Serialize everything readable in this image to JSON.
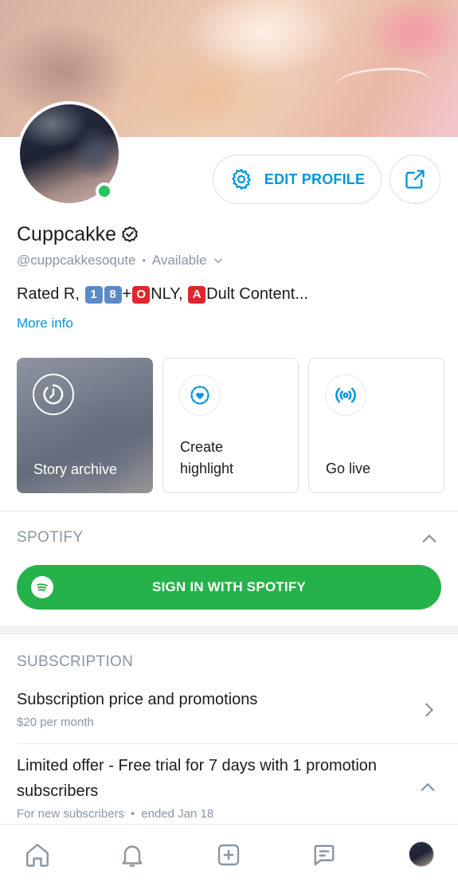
{
  "profile": {
    "name": "Cuppcakke",
    "handle": "@cuppcakkesoqute",
    "separator": "•",
    "status": "Available",
    "bio_prefix": "Rated R,",
    "bio_d1": "1",
    "bio_d2": "8",
    "bio_plus": "+",
    "bio_o": "O",
    "bio_nly": "NLY,",
    "bio_a": "A",
    "bio_dult": "Dult Content...",
    "more_info": "More info",
    "online": true
  },
  "actions": {
    "edit_profile": "EDIT PROFILE"
  },
  "cards": {
    "archive": "Story archive",
    "highlight_l1": "Create",
    "highlight_l2": "highlight",
    "live": "Go live"
  },
  "spotify": {
    "title": "SPOTIFY",
    "sign_in": "SIGN IN WITH SPOTIFY"
  },
  "subscription": {
    "title": "SUBSCRIPTION",
    "price_title": "Subscription price and promotions",
    "price_sub": "$20 per month",
    "offer_title": "Limited offer - Free trial for 7 days with 1 promotion subscribers",
    "offer_audience": "For new subscribers",
    "offer_sep": "•",
    "offer_end": "ended Jan 18"
  },
  "colors": {
    "accent": "#0097d9",
    "spotify_green": "#26b24b",
    "online_green": "#22c55e",
    "muted": "#8a96a3"
  },
  "icons": {
    "edit": "gear-icon",
    "share": "share-icon",
    "verified": "verified-badge-icon",
    "archive": "clock-history-icon",
    "highlight": "heart-dashed-circle-icon",
    "live": "broadcast-icon",
    "nav": [
      "home-icon",
      "bell-icon",
      "add-post-icon",
      "messages-icon",
      "profile-avatar"
    ]
  }
}
